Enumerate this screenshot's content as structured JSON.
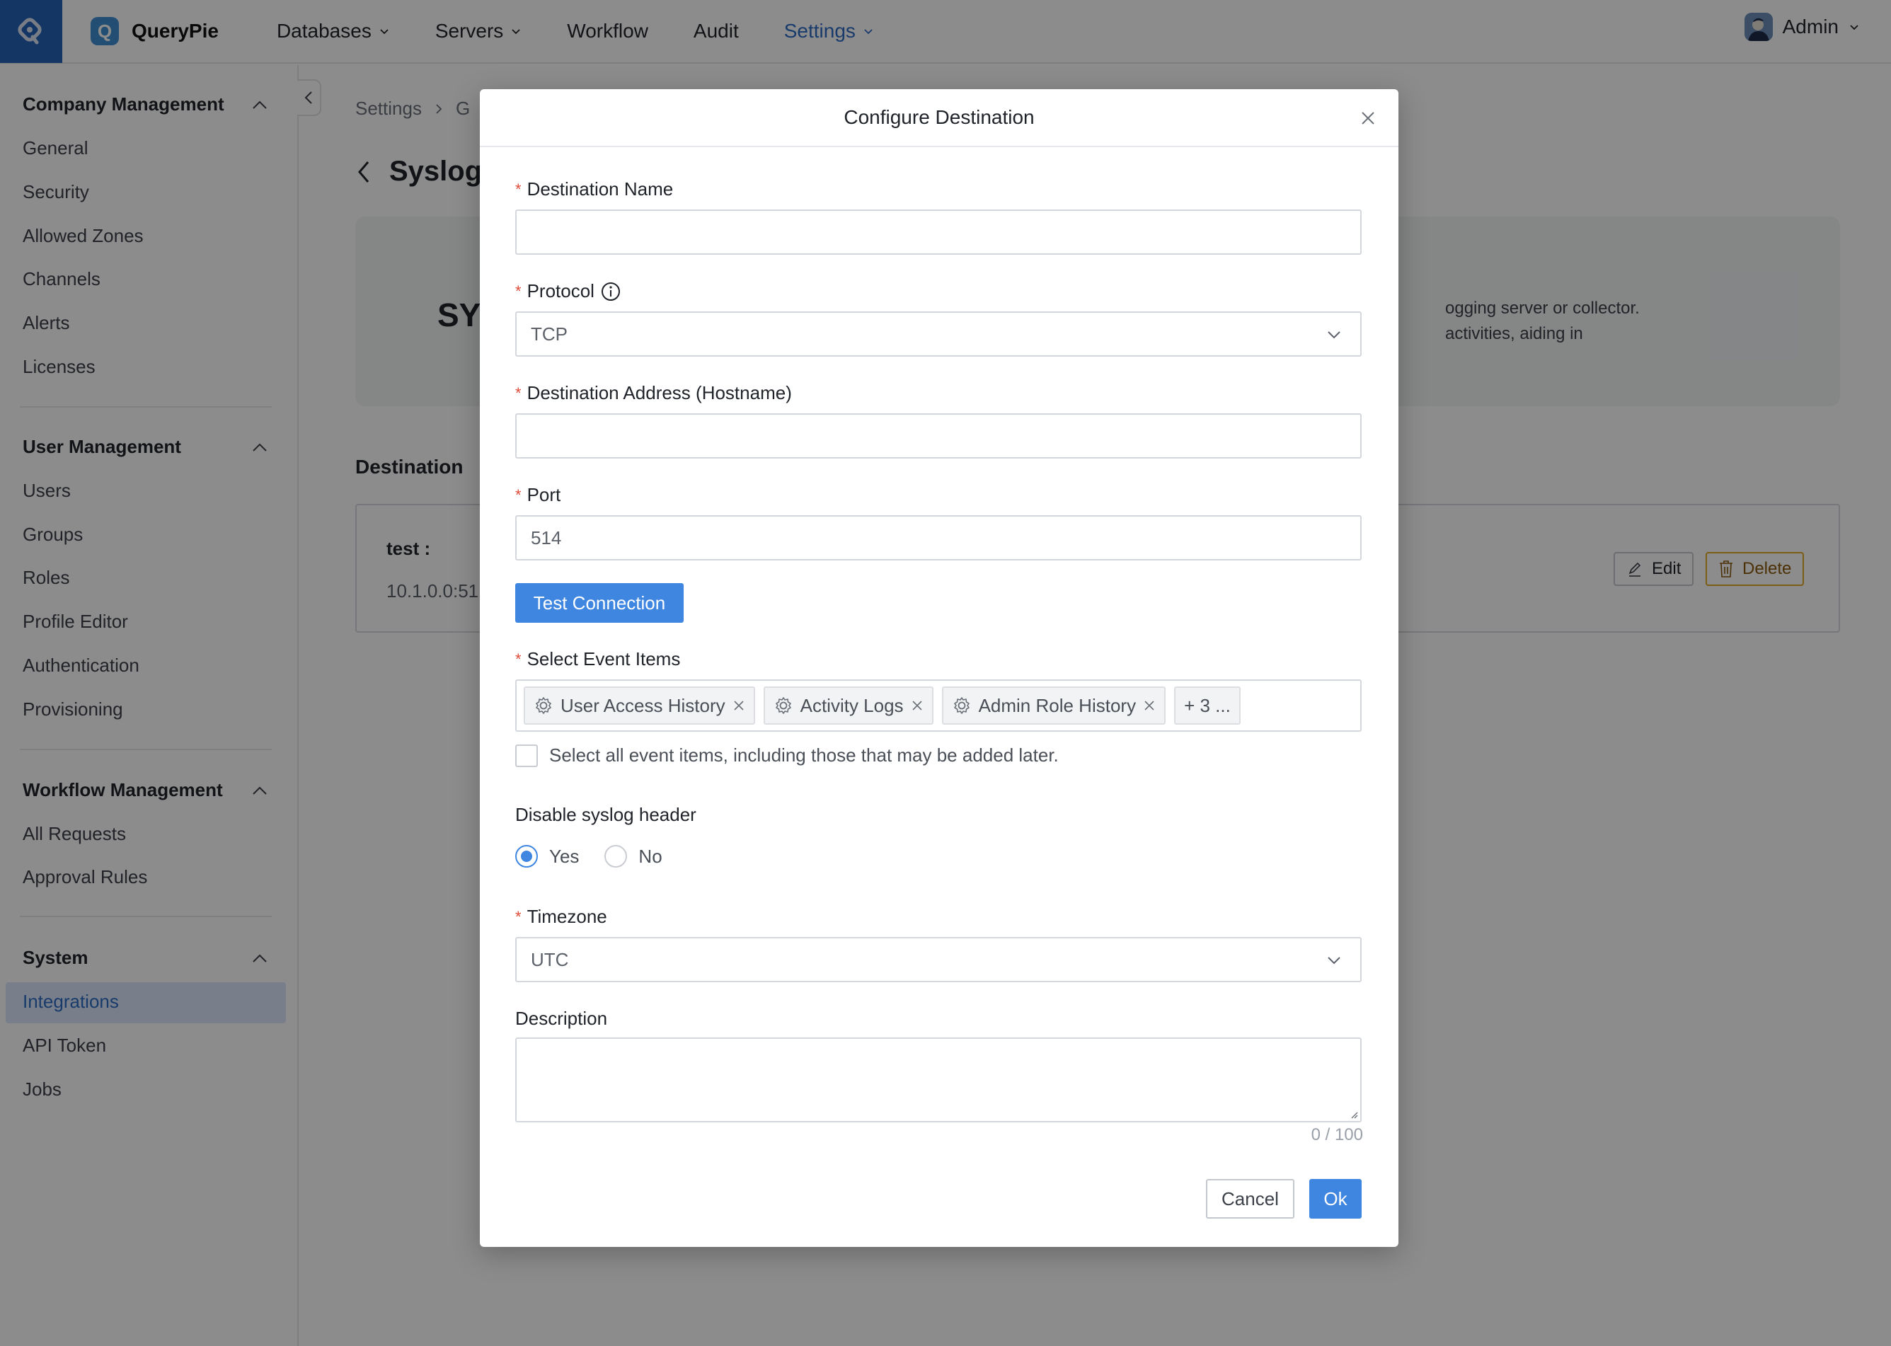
{
  "topnav": {
    "brand": "QueryPie",
    "brand_initial": "Q",
    "items": [
      {
        "label": "Databases",
        "has_menu": true
      },
      {
        "label": "Servers",
        "has_menu": true
      },
      {
        "label": "Workflow",
        "has_menu": false
      },
      {
        "label": "Audit",
        "has_menu": false
      },
      {
        "label": "Settings",
        "has_menu": true,
        "active": true
      }
    ],
    "user": "Admin"
  },
  "sidebar": {
    "sections": [
      {
        "title": "Company Management",
        "items": [
          "General",
          "Security",
          "Allowed Zones",
          "Channels",
          "Alerts",
          "Licenses"
        ]
      },
      {
        "title": "User Management",
        "items": [
          "Users",
          "Groups",
          "Roles",
          "Profile Editor",
          "Authentication",
          "Provisioning"
        ]
      },
      {
        "title": "Workflow Management",
        "items": [
          "All Requests",
          "Approval Rules"
        ]
      },
      {
        "title": "System",
        "items": [
          "Integrations",
          "API Token",
          "Jobs"
        ]
      }
    ],
    "active_item": "Integrations"
  },
  "page": {
    "breadcrumb": [
      "Settings",
      "G"
    ],
    "title": "Syslog",
    "hero_title": "SYS",
    "hero_desc_line1": "ogging server or collector.",
    "hero_desc_line2": "activities, aiding in",
    "destination_heading": "Destination",
    "destination_card": {
      "name": "test :",
      "address": "10.1.0.0:51",
      "edit_label": "Edit",
      "delete_label": "Delete"
    }
  },
  "modal": {
    "title": "Configure Destination",
    "fields": {
      "destination_name": {
        "label": "Destination Name",
        "value": "",
        "required": true
      },
      "protocol": {
        "label": "Protocol",
        "value": "TCP",
        "required": true
      },
      "address": {
        "label": "Destination Address (Hostname)",
        "value": "",
        "required": true
      },
      "port": {
        "label": "Port",
        "value": "514",
        "required": true
      },
      "event_items": {
        "label": "Select Event Items",
        "required": true,
        "tags": [
          "User Access History",
          "Activity Logs",
          "Admin Role History"
        ],
        "more": "+ 3 ...",
        "select_all_label": "Select all event items, including those that may be added later.",
        "select_all_checked": false
      },
      "syslog_header": {
        "label": "Disable syslog header",
        "options": [
          "Yes",
          "No"
        ],
        "selected": "Yes"
      },
      "timezone": {
        "label": "Timezone",
        "value": "UTC",
        "required": true
      },
      "description": {
        "label": "Description",
        "value": "",
        "counter": "0 / 100"
      }
    },
    "test_connection_label": "Test Connection",
    "cancel_label": "Cancel",
    "ok_label": "Ok",
    "required_mark": "*"
  },
  "colors": {
    "primary": "#3f86e0",
    "brand": "#2563b8",
    "required": "#e04b3a",
    "delete": "#e2a928"
  }
}
